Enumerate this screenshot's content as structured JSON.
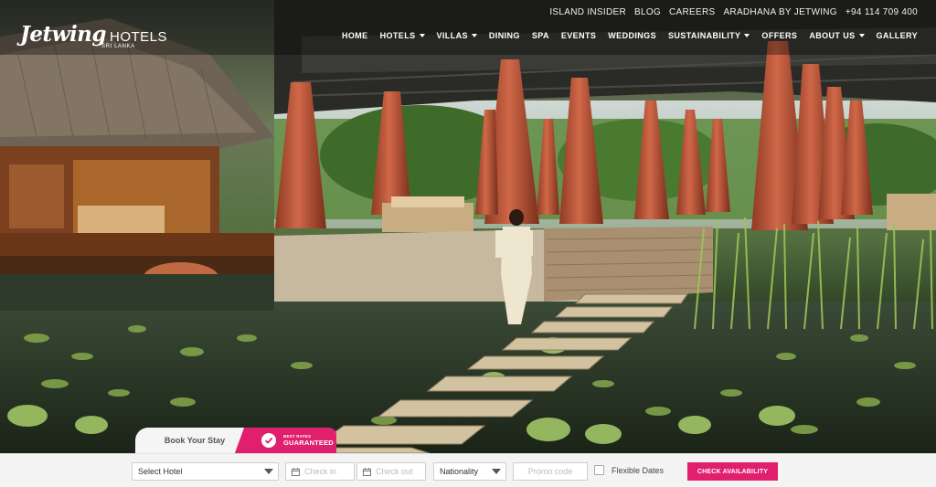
{
  "brand": {
    "name": "Jetwing",
    "suffix": "HOTELS",
    "subtitle": "SRI LANKA"
  },
  "top_links": [
    "ISLAND INSIDER",
    "BLOG",
    "CAREERS",
    "ARADHANA BY JETWING",
    "+94 114 709 400"
  ],
  "nav": [
    {
      "label": "HOME",
      "dropdown": false
    },
    {
      "label": "HOTELS",
      "dropdown": true
    },
    {
      "label": "VILLAS",
      "dropdown": true
    },
    {
      "label": "DINING",
      "dropdown": false
    },
    {
      "label": "SPA",
      "dropdown": false
    },
    {
      "label": "EVENTS",
      "dropdown": false
    },
    {
      "label": "WEDDINGS",
      "dropdown": false
    },
    {
      "label": "SUSTAINABILITY",
      "dropdown": true
    },
    {
      "label": "OFFERS",
      "dropdown": false
    },
    {
      "label": "ABOUT US",
      "dropdown": true
    },
    {
      "label": "GALLERY",
      "dropdown": false
    }
  ],
  "booking": {
    "tab_label": "Book Your Stay",
    "badge_small": "BEST RATES",
    "badge_big": "GUARANTEED",
    "hotel_select": "Select Hotel",
    "check_in_placeholder": "Check in",
    "check_out_placeholder": "Check out",
    "nationality_select": "Nationality",
    "promo_placeholder": "Promo code",
    "flexible_label": "Flexible Dates",
    "cta_label": "CHECK AVAILABILITY"
  },
  "colors": {
    "accent": "#e01f6e",
    "bar_bg": "#f4f4f4"
  }
}
